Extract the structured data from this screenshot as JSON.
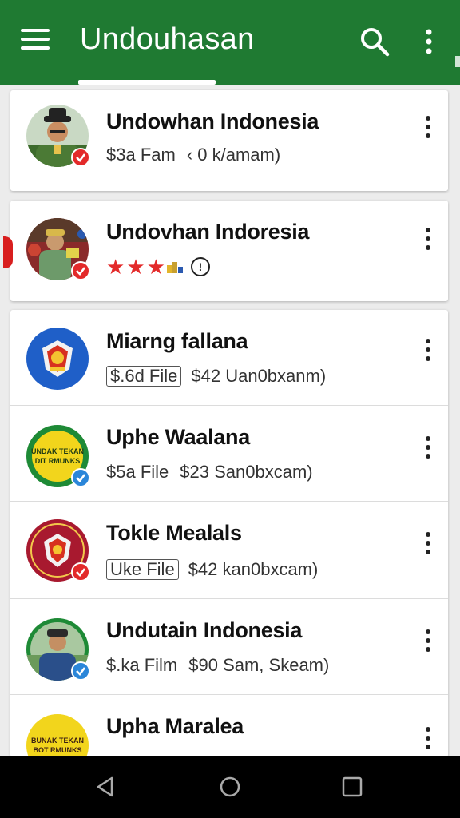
{
  "app": {
    "title": "Undouhasan",
    "accent": "#1f7a32",
    "badge_red": "#e32a2a",
    "badge_blue": "#2b86d9"
  },
  "items": [
    {
      "name": "Undowhan Indonesia",
      "meta_plain_1": "$3a Fam",
      "meta_plain_2": "‹ 0 k/amam)",
      "badge": "red",
      "avatar": "man-hat"
    },
    {
      "name": "Undovhan Indoresia",
      "rating_stars": 3,
      "rating_extra": "★ ☆",
      "warn_glyph": "!",
      "badge": "red",
      "avatar": "man-crowd"
    },
    {
      "name": "Miarng fallana",
      "tag": "$.6d File",
      "meta": "$42 Uan0bxanm)",
      "badge": "none",
      "avatar": "emblem-blue"
    },
    {
      "name": "Uphe Waalana",
      "meta_plain_1": "$5a File",
      "meta": "$23 San0bxcam)",
      "badge": "blue",
      "avatar": "logo-yellow",
      "logo_text_1": "UNDAK TEKAN",
      "logo_text_2": "DIT RMUNKS"
    },
    {
      "name": "Tokle Mealals",
      "tag": "Uke File",
      "meta": "$42 kan0bxcam)",
      "badge": "red",
      "avatar": "emblem-red"
    },
    {
      "name": "Undutain Indonesia",
      "meta_plain_1": "$.ka Film",
      "meta": "$90 Sam, Skeam)",
      "badge": "blue",
      "avatar": "man-field"
    },
    {
      "name": "Upha Maralea",
      "badge": "none",
      "avatar": "logo-yellow-2",
      "logo_text_1": "BUNAK TEKAN",
      "logo_text_2": "BOT RMUNKS"
    }
  ]
}
